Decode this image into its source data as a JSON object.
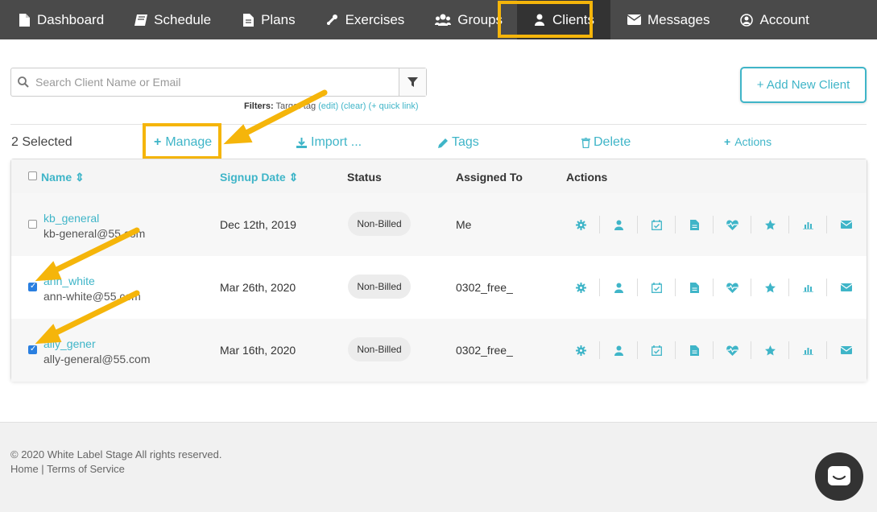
{
  "nav": {
    "items": [
      {
        "label": "Dashboard",
        "icon": "document-icon"
      },
      {
        "label": "Schedule",
        "icon": "book-icon"
      },
      {
        "label": "Plans",
        "icon": "file-icon"
      },
      {
        "label": "Exercises",
        "icon": "wrench-icon"
      },
      {
        "label": "Groups",
        "icon": "users-icon"
      },
      {
        "label": "Clients",
        "icon": "user-icon",
        "active": true
      },
      {
        "label": "Messages",
        "icon": "envelope-icon"
      },
      {
        "label": "Account",
        "icon": "user-circle-icon"
      }
    ]
  },
  "search": {
    "placeholder": "Search Client Name or Email",
    "value": ""
  },
  "filters": {
    "label": "Filters:",
    "text": " Target-tag ",
    "edit": "(edit)",
    "clear": "(clear)",
    "quick": "(+ quick link)"
  },
  "add_client_label": "+ Add New Client",
  "toolbar": {
    "selected": "2 Selected",
    "manage": "Manage",
    "import": "Import ...",
    "tags": "Tags",
    "delete": "Delete",
    "actions": "Actions"
  },
  "table": {
    "headers": {
      "name": "Name",
      "signup": "Signup Date",
      "status": "Status",
      "assigned": "Assigned To",
      "actions": "Actions"
    },
    "rows": [
      {
        "username": "kb_general",
        "email": "kb-general@55.com",
        "signup": "Dec 12th, 2019",
        "status": "Non-Billed",
        "assigned": "Me",
        "checked": false
      },
      {
        "username": "ann_white",
        "email": "ann-white@55.com",
        "signup": "Mar 26th, 2020",
        "status": "Non-Billed",
        "assigned": "0302_free_",
        "checked": true
      },
      {
        "username": "ally_gener",
        "email": "ally-general@55.com",
        "signup": "Mar 16th, 2020",
        "status": "Non-Billed",
        "assigned": "0302_free_",
        "checked": true
      }
    ],
    "row_actions": [
      "gear-icon",
      "user-icon",
      "calendar-check-icon",
      "file-icon",
      "heartbeat-icon",
      "star-icon",
      "bar-chart-icon",
      "envelope-icon"
    ]
  },
  "footer": {
    "copyright": "© 2020 White Label Stage All rights reserved.",
    "home": "Home",
    "sep": " | ",
    "terms": "Terms of Service"
  },
  "colors": {
    "accent": "#3fb5c8",
    "highlight": "#f5b50a",
    "nav_bg": "#4a4a4a"
  }
}
